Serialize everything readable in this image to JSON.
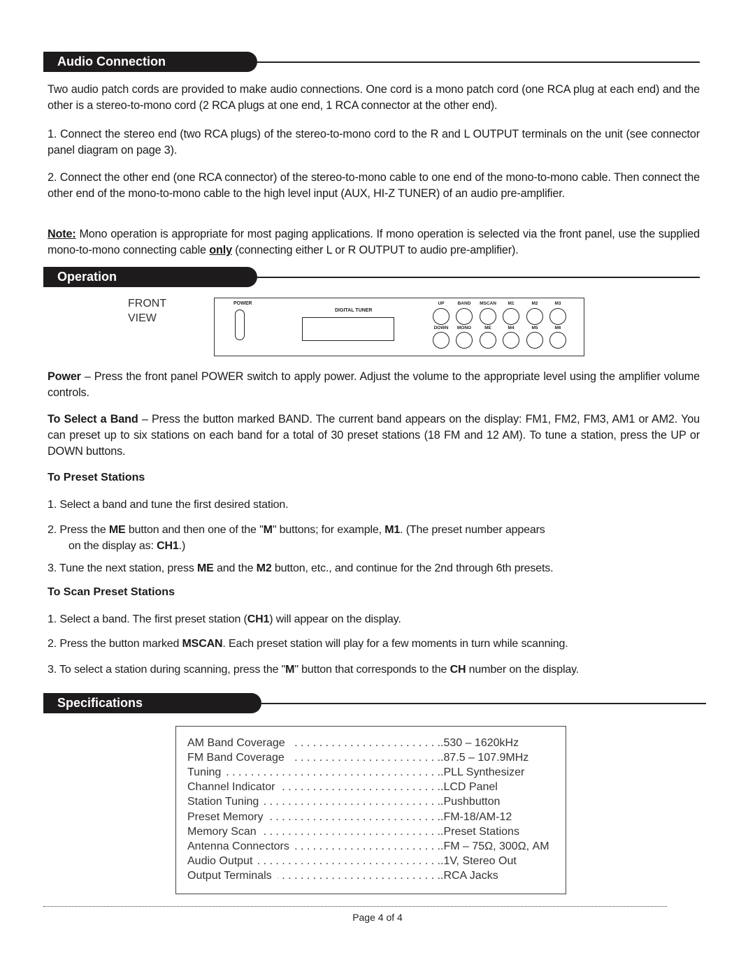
{
  "sections": {
    "audio": {
      "title": "Audio Connection",
      "intro": "Two audio patch cords are provided to make audio connections. One cord is a mono patch cord (one RCA plug at each end) and the other is a stereo-to-mono cord (2 RCA plugs at one end, 1 RCA connector at the other end).",
      "step1": "1. Connect the stereo end (two RCA plugs) of the stereo-to-mono cord to the R and L OUTPUT terminals on the unit (see connector panel diagram on page 3).",
      "step2": "2. Connect the other end (one RCA connector) of the stereo-to-mono cable to one end of the mono-to-mono cable. Then connect the other end of the mono-to-mono cable to the high level input (AUX, HI-Z TUNER) of an audio pre-amplifier.",
      "note_label": "Note:",
      "note_text_a": " Mono operation is appropriate for most paging applications. If mono operation is selected via the front panel, use the supplied mono-to-mono connecting cable ",
      "note_emph": "only",
      "note_text_b": " (connecting either L or R OUTPUT to audio pre-amplifier)."
    },
    "operation": {
      "title": "Operation",
      "front_view_line1": "FRONT",
      "front_view_line2": "VIEW",
      "panel": {
        "power_label": "POWER",
        "display_label": "DIGITAL TUNER",
        "buttons_top": [
          "UP",
          "BAND",
          "MSCAN",
          "M1",
          "M2",
          "M3"
        ],
        "buttons_bottom": [
          "DOWN",
          "MONO",
          "ME",
          "M4",
          "M5",
          "M6"
        ]
      },
      "power_label": "Power",
      "power_text": " – Press the front panel POWER switch to apply power.  Adjust the volume to the appropriate level using the amplifier volume controls.",
      "band_label": "To Select a Band",
      "band_text": " – Press the button marked BAND. The current band appears on the display: FM1, FM2, FM3, AM1 or AM2. You can preset up to six stations on each band for a total of 30 preset stations (18 FM and 12 AM). To tune a station, press the UP or DOWN buttons.",
      "preset": {
        "heading": "To Preset Stations",
        "item1": "1.  Select a band and tune the first desired station.",
        "item2_a": "2.  Press the ",
        "item2_b1": "ME",
        "item2_c": " button and then one of the \"",
        "item2_b2": "M",
        "item2_d": "\" buttons; for example, ",
        "item2_b3": "M1",
        "item2_e": ". (The preset number appears",
        "item2_f": "on the display as: ",
        "item2_b4": "CH1",
        "item2_g": ".)",
        "item3_a": "3.  Tune the next station, press ",
        "item3_b1": "ME",
        "item3_c": " and the ",
        "item3_b2": "M2",
        "item3_d": " button, etc., and continue for the 2nd through 6th presets."
      },
      "scan": {
        "heading": "To Scan Preset Stations",
        "item1_a": "1. Select a band.  The first preset station (",
        "item1_b": "CH1",
        "item1_c": ") will appear on the display.",
        "item2_a": "2. Press the button marked ",
        "item2_b": "MSCAN",
        "item2_c": ".  Each preset station will play for a few moments in turn while scanning.",
        "item3_a": "3. To select a station during scanning, press the \"",
        "item3_b": "M",
        "item3_c": "\" button that corresponds to the ",
        "item3_d": "CH",
        "item3_e": " number on the display."
      }
    },
    "specs": {
      "title": "Specifications",
      "rows": [
        {
          "k": "AM Band Coverage",
          "v": ".530 – 1620kHz"
        },
        {
          "k": "FM Band Coverage",
          "v": ".87.5 – 107.9MHz"
        },
        {
          "k": "Tuning",
          "v": ".PLL Synthesizer"
        },
        {
          "k": "Channel Indicator",
          "v": ".LCD Panel"
        },
        {
          "k": "Station Tuning",
          "v": ".Pushbutton"
        },
        {
          "k": "Preset Memory",
          "v": ".FM-18/AM-12"
        },
        {
          "k": "Memory Scan",
          "v": ".Preset Stations"
        },
        {
          "k": "Antenna Connectors",
          "v": ".FM – 75Ω, 300Ω, AM"
        },
        {
          "k": "Audio Output",
          "v": ".1V, Stereo Out"
        },
        {
          "k": "Output Terminals",
          "v": ".RCA Jacks"
        }
      ]
    }
  },
  "footer": {
    "page": "Page 4 of 4"
  }
}
